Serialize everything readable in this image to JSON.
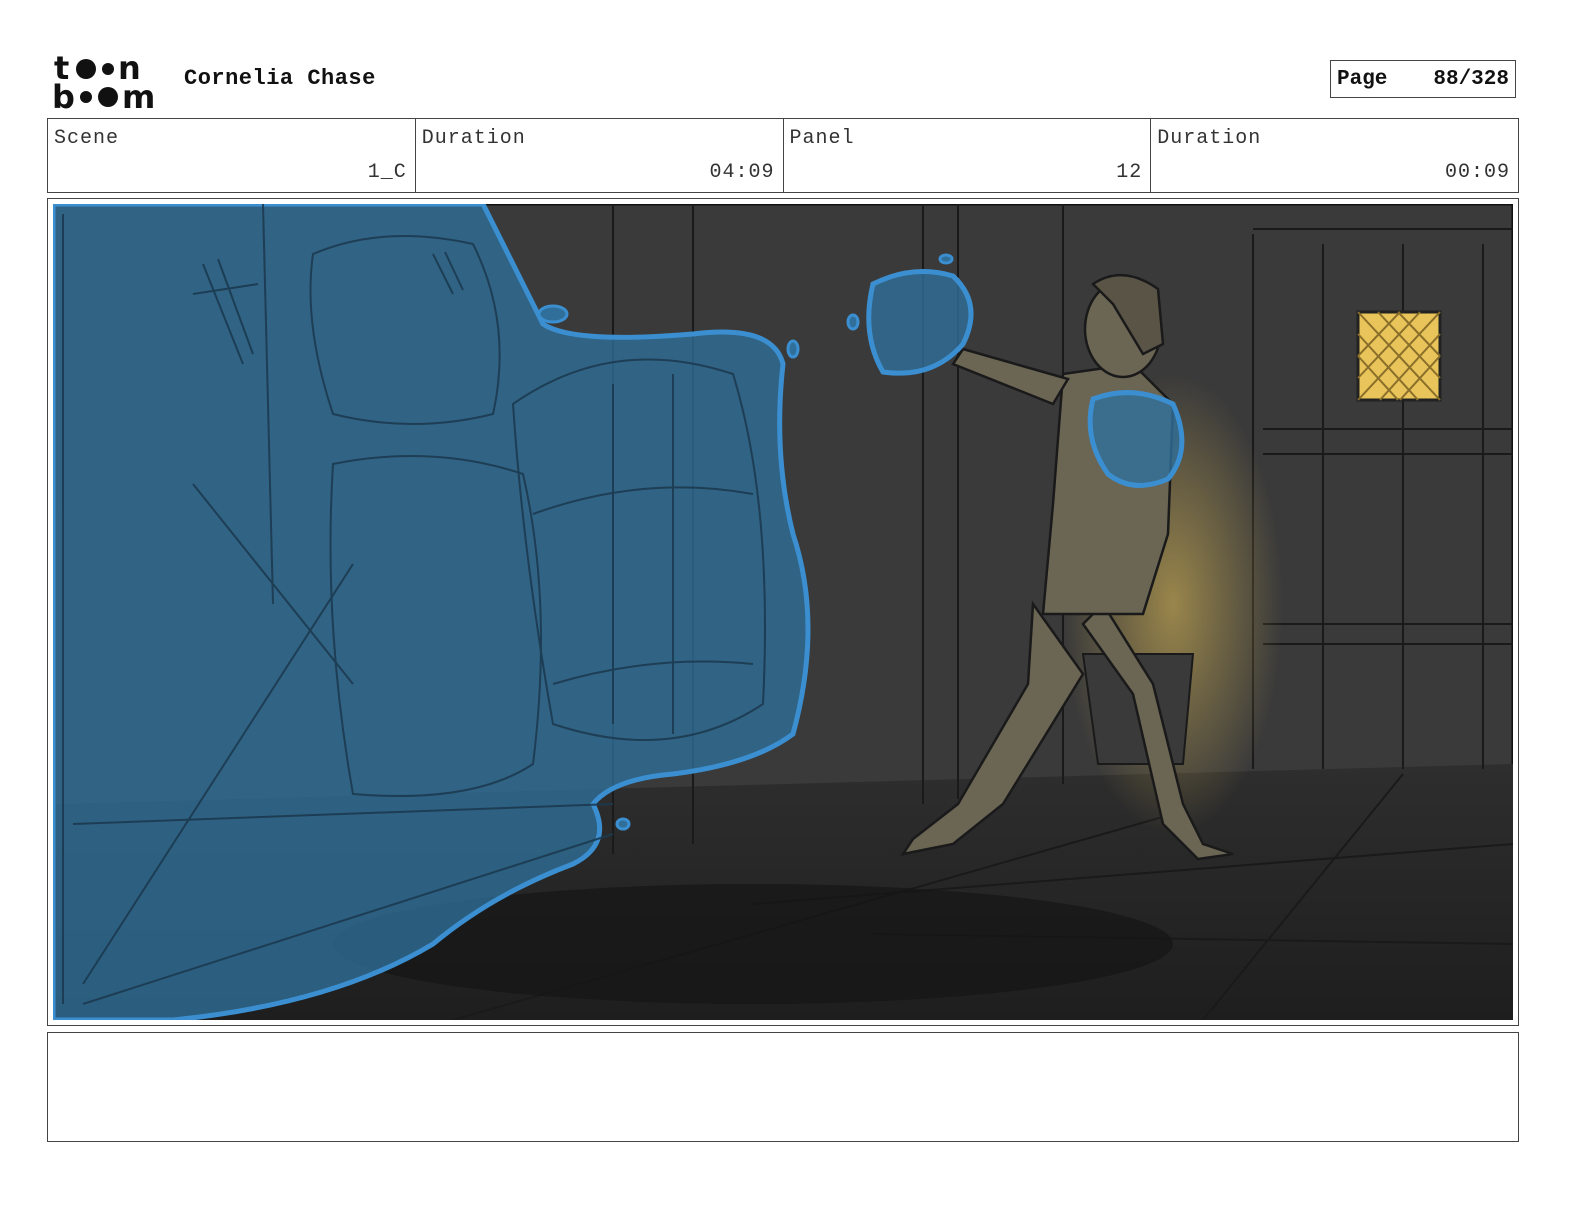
{
  "header": {
    "logo_icon": "toon-boom-logo-icon",
    "project_title": "Cornelia Chase",
    "page_label": "Page",
    "page_number": "88/328"
  },
  "info": {
    "scene_label": "Scene",
    "scene_value": "1_C",
    "scene_duration_label": "Duration",
    "scene_duration_value": "04:09",
    "panel_label": "Panel",
    "panel_value": "12",
    "panel_duration_label": "Duration",
    "panel_duration_value": "00:09"
  },
  "panel": {
    "image_icon": "storyboard-panel-drawing",
    "colors": {
      "background": "#3a3a3a",
      "floor": "#2a2a2a",
      "water": "#2f6f9a",
      "water_outline": "#3b8fd0",
      "character": "#6b6554",
      "window_glow": "#e8c45a"
    }
  },
  "notes": {
    "text": ""
  }
}
